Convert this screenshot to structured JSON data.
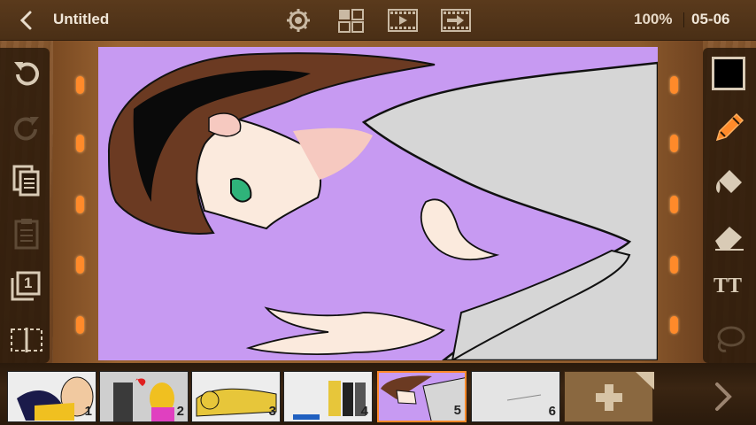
{
  "header": {
    "title": "Untitled",
    "zoom": "100%",
    "frame_indicator": "05-06",
    "icons": [
      "back-icon",
      "settings-icon",
      "layout-grid-icon",
      "play-icon",
      "export-icon"
    ]
  },
  "left_toolbar": {
    "items": [
      "undo-icon",
      "redo-icon",
      "copy-icon",
      "paste-icon",
      "layer-icon",
      "split-frame-icon"
    ],
    "layer_number": "1"
  },
  "right_toolbar": {
    "items": [
      "color-swatch",
      "pencil-icon",
      "fill-bucket-icon",
      "eraser-icon",
      "text-icon",
      "lasso-icon"
    ],
    "text_tool_label": "TT",
    "current_color": "#000000",
    "active_tool": "pencil-icon"
  },
  "frames": [
    {
      "number": "1"
    },
    {
      "number": "2"
    },
    {
      "number": "3"
    },
    {
      "number": "4"
    },
    {
      "number": "5",
      "selected": true
    },
    {
      "number": "6"
    }
  ],
  "add_frame_icon": "plus-icon",
  "colors": {
    "accent": "#ff8a2a",
    "canvas_background": "#c79af2",
    "wood": "#7a4b25"
  }
}
